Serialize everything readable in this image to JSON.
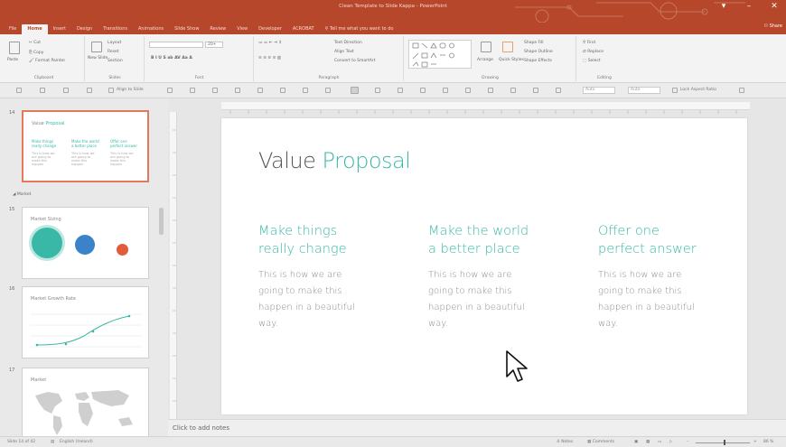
{
  "window": {
    "title": "Clean Template to Slide Kappa - PowerPoint",
    "share_label": "Share",
    "controls": [
      "▾",
      "–",
      "✕"
    ]
  },
  "tabs": [
    {
      "label": "File"
    },
    {
      "label": "Home"
    },
    {
      "label": "Insert"
    },
    {
      "label": "Design"
    },
    {
      "label": "Transitions"
    },
    {
      "label": "Animations"
    },
    {
      "label": "Slide Show"
    },
    {
      "label": "Review"
    },
    {
      "label": "View"
    },
    {
      "label": "Developer"
    },
    {
      "label": "ACROBAT"
    }
  ],
  "tell_me": "Tell me what you want to do",
  "ribbon": {
    "clipboard": {
      "label": "Clipboard",
      "paste": "Paste",
      "cut": "Cut",
      "copy": "Copy",
      "format_painter": "Format Painter"
    },
    "slides": {
      "label": "Slides",
      "new_slide": "New Slide",
      "layout": "Layout",
      "reset": "Reset",
      "section": "Section"
    },
    "font": {
      "label": "Font",
      "size": "20+"
    },
    "paragraph": {
      "label": "Paragraph",
      "text_direction": "Text Direction",
      "align_text": "Align Text",
      "convert": "Convert to SmartArt"
    },
    "drawing": {
      "label": "Drawing",
      "arrange": "Arrange",
      "quick_styles": "Quick Styles",
      "shape_fill": "Shape Fill",
      "shape_outline": "Shape Outline",
      "shape_effects": "Shape Effects"
    },
    "editing": {
      "label": "Editing",
      "find": "Find",
      "replace": "Replace",
      "select": "Select"
    }
  },
  "toolbar2": {
    "align_to_slide": "Align to Slide",
    "lock_aspect": "Lock Aspect Ratio",
    "width_placeholder": "Auto",
    "height_placeholder": "Auto"
  },
  "thumbnails": {
    "slide14": {
      "num": "14",
      "title_a": "Value ",
      "title_b": "Proposal",
      "cols": [
        {
          "head": "Make things really change",
          "body": "This is how we are going to make this happen"
        },
        {
          "head": "Make the world a better place",
          "body": "This is how we are going to make this happen"
        },
        {
          "head": "Offer one perfect answer",
          "body": "This is how we are going to make this happen"
        }
      ]
    },
    "section": "Market",
    "slide15": {
      "num": "15",
      "title": "Market Sizing"
    },
    "slide16": {
      "num": "16",
      "title": "Market Growth Rate"
    },
    "slide17": {
      "num": "17",
      "title": "Market"
    }
  },
  "slide": {
    "title_a": "Value ",
    "title_b": "Proposal",
    "columns": [
      {
        "head1": "Make things",
        "head2": "really change",
        "b1": "This is how we are",
        "b2": "going to make this",
        "b3": "happen in a beautiful",
        "b4": "way."
      },
      {
        "head1": "Make the world",
        "head2": "a better place",
        "b1": "This is how we are",
        "b2": "going to make this",
        "b3": "happen in a beautiful",
        "b4": "way."
      },
      {
        "head1": "Offer one",
        "head2": "perfect answer",
        "b1": "This is how we are",
        "b2": "going to make this",
        "b3": "happen in a beautiful",
        "b4": "way."
      }
    ]
  },
  "notes": {
    "placeholder": "Click to add notes"
  },
  "status": {
    "slide_of": "Slide 14 of 42",
    "language": "English (Ireland)",
    "notes_btn": "Notes",
    "comments_btn": "Comments",
    "zoom": "86 %"
  },
  "colors": {
    "accent": "#3ab8a7",
    "titlebar": "#b7472a",
    "selected_thumb": "#e07b5a"
  }
}
